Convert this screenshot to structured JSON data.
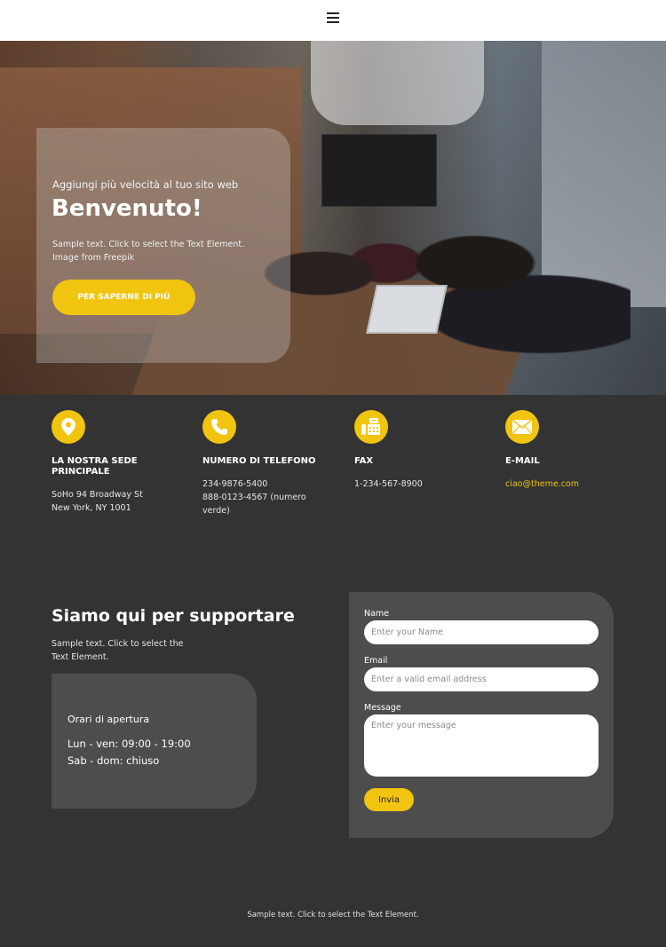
{
  "header": {
    "menu_icon": "hamburger-icon"
  },
  "hero": {
    "image_description": "office meeting room with people at a conference table",
    "subtitle": "Aggiungi più velocità al tuo sito web",
    "title": "Benvenuto!",
    "text": "Sample text. Click to select the Text Element. Image from Freepik",
    "button_label": "PER SAPERNE DI PIÙ"
  },
  "info": [
    {
      "icon": "map-pin-icon",
      "label": "LA NOSTRA SEDE PRINCIPALE",
      "lines": [
        "SoHo 94 Broadway St New York, NY 1001"
      ]
    },
    {
      "icon": "phone-icon",
      "label": "NUMERO DI TELEFONO",
      "lines": [
        "234-9876-5400",
        "888-0123-4567 (numero verde)"
      ]
    },
    {
      "icon": "fax-icon",
      "label": "FAX",
      "lines": [
        "1-234-567-8900"
      ]
    },
    {
      "icon": "envelope-icon",
      "label": "E-MAIL",
      "lines": [
        "ciao@theme.com"
      ]
    }
  ],
  "support": {
    "title": "Siamo qui per supportare",
    "text": "Sample text. Click to select the Text Element.",
    "hours": {
      "title": "Orari di apertura",
      "lines": [
        "Lun - ven: 09:00 - 19:00",
        "Sab - dom: chiuso"
      ]
    }
  },
  "form": {
    "name_label": "Name",
    "name_placeholder": "Enter your Name",
    "email_label": "Email",
    "email_placeholder": "Enter a valid email address",
    "message_label": "Message",
    "message_placeholder": "Enter your message",
    "submit_label": "Invia"
  },
  "footer": {
    "text": "Sample text. Click to select the Text Element."
  },
  "colors": {
    "accent": "#f1c40f",
    "background": "#333333",
    "panel": "#4d4d4d",
    "header": "#ffffff"
  }
}
